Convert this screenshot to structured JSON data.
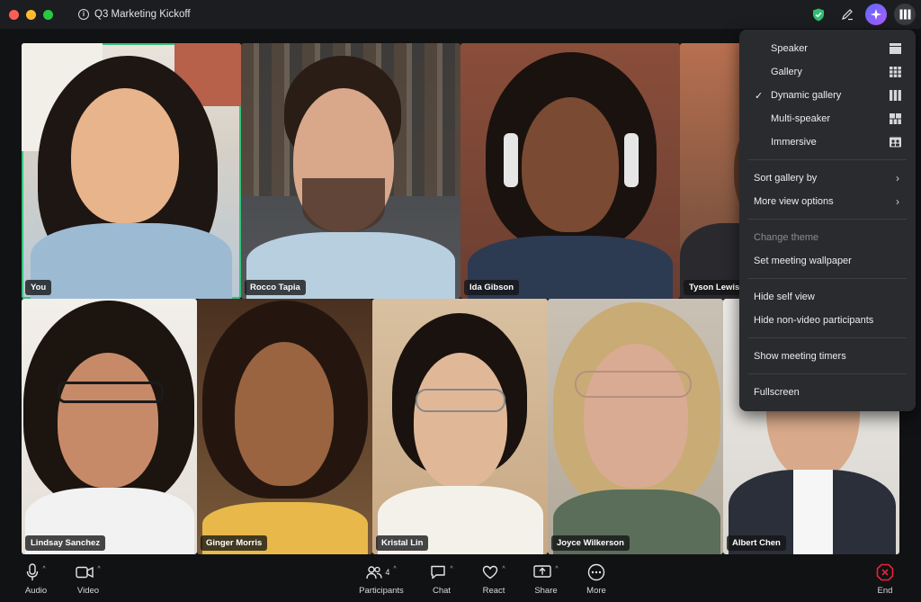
{
  "window": {
    "title": "Q3 Marketing Kickoff"
  },
  "participants": [
    {
      "name": "You",
      "self": true
    },
    {
      "name": "Rocco Tapia"
    },
    {
      "name": "Ida Gibson"
    },
    {
      "name": "Tyson Lewis"
    },
    {
      "name": "Lindsay Sanchez"
    },
    {
      "name": "Ginger Morris"
    },
    {
      "name": "Kristal Lin"
    },
    {
      "name": "Joyce Wilkerson"
    },
    {
      "name": "Albert Chen"
    }
  ],
  "view_menu": {
    "layouts": [
      {
        "label": "Speaker",
        "icon": "speaker-view-icon",
        "checked": false
      },
      {
        "label": "Gallery",
        "icon": "gallery-view-icon",
        "checked": false
      },
      {
        "label": "Dynamic gallery",
        "icon": "dynamic-gallery-icon",
        "checked": true
      },
      {
        "label": "Multi-speaker",
        "icon": "multi-speaker-icon",
        "checked": false
      },
      {
        "label": "Immersive",
        "icon": "immersive-view-icon",
        "checked": false
      }
    ],
    "sort_gallery": "Sort gallery by",
    "more_view_options": "More view options",
    "change_theme": "Change theme",
    "set_wallpaper": "Set meeting wallpaper",
    "hide_self_view": "Hide self view",
    "hide_non_video": "Hide non-video participants",
    "show_timers": "Show meeting timers",
    "fullscreen": "Fullscreen",
    "check_mark": "✓",
    "chevron": "›"
  },
  "toolbar": {
    "audio": "Audio",
    "video": "Video",
    "participants": "Participants",
    "participant_count": "4",
    "chat": "Chat",
    "react": "React",
    "share": "Share",
    "more": "More",
    "end": "End"
  },
  "colors": {
    "accent_green": "#35c27a",
    "end_red": "#e5243b",
    "menu_bg": "#2a2b2e"
  }
}
